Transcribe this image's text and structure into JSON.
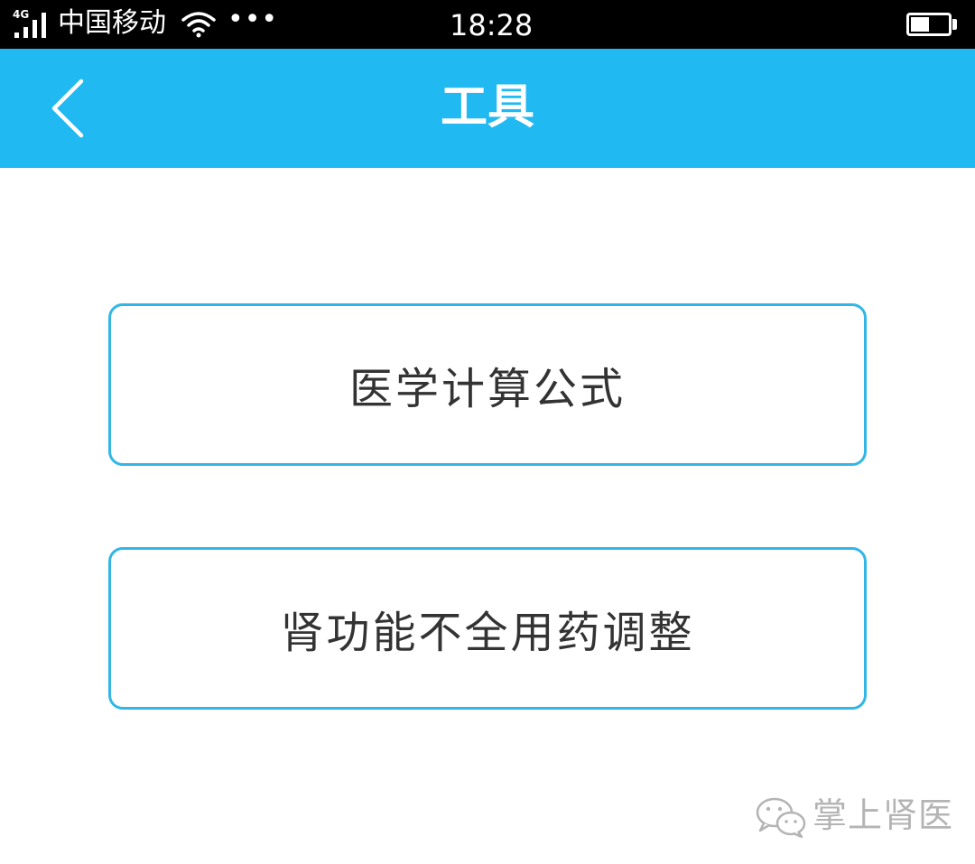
{
  "status_bar": {
    "network_type": "4G",
    "carrier": "中国移动",
    "more_indicator": "•••",
    "time": "18:28",
    "icons": [
      "signal-icon",
      "wifi-icon",
      "battery-icon"
    ]
  },
  "header": {
    "title": "工具",
    "background_color": "#21b9f2",
    "back_icon": "chevron-left-icon"
  },
  "tools": [
    {
      "label": "医学计算公式"
    },
    {
      "label": "肾功能不全用药调整"
    }
  ],
  "watermark": {
    "icon": "wechat-icon",
    "text": "掌上肾医"
  },
  "colors": {
    "accent": "#21b9f2",
    "button_border": "#33b6e6",
    "button_text": "#333333",
    "watermark": "#b4b4b4"
  }
}
